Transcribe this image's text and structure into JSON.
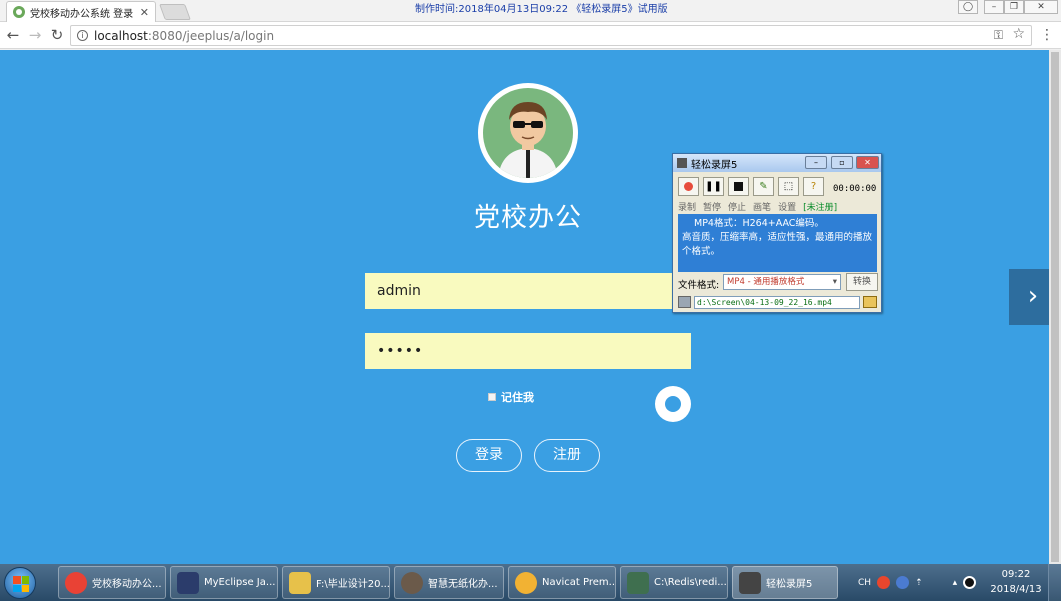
{
  "browser": {
    "tab_title": "党校移动办公系统 登录",
    "tab_close": "✕",
    "recording_caption": "制作时间:2018年04月13日09:22 《轻松录屏5》试用版",
    "url_host": "localhost",
    "url_path": ":8080/jeeplus/a/login"
  },
  "page": {
    "site_title": "党校办公",
    "username_value": "admin",
    "password_value": "•••••",
    "remember_label": "记住我",
    "login_label": "登录",
    "register_label": "注册",
    "next_arrow": "›"
  },
  "recorder": {
    "title": "轻松录屏5",
    "timer": "00:00:00",
    "control_labels": [
      "录制",
      "暂停",
      "停止",
      "画笔",
      "设置"
    ],
    "unregistered": "[未注册]",
    "info_line1": "MP4格式：H264+AAC编码。",
    "info_line2": "高音质，压缩率高，适应性强，最通用的播放个格式。",
    "format_label": "文件格式:",
    "format_value": "MP4 - 通用播放格式",
    "convert_label": "转换",
    "file_path": "d:\\Screen\\04-13-09_22_16.mp4"
  },
  "taskbar": {
    "items": [
      {
        "label": "党校移动办公...",
        "color": "#e94235"
      },
      {
        "label": "MyEclipse Ja...",
        "color": "#2b3c6b"
      },
      {
        "label": "F:\\毕业设计20...",
        "color": "#e7c14a"
      },
      {
        "label": "智慧无纸化办...",
        "color": "#6b5a4a"
      },
      {
        "label": "Navicat Prem...",
        "color": "#f2b233"
      },
      {
        "label": "C:\\Redis\\redi...",
        "color": "#3f6f4f"
      },
      {
        "label": "轻松录屏5",
        "color": "#444444"
      }
    ],
    "tray_lang": "CH",
    "clock_time": "09:22",
    "clock_date": "2018/4/13"
  }
}
